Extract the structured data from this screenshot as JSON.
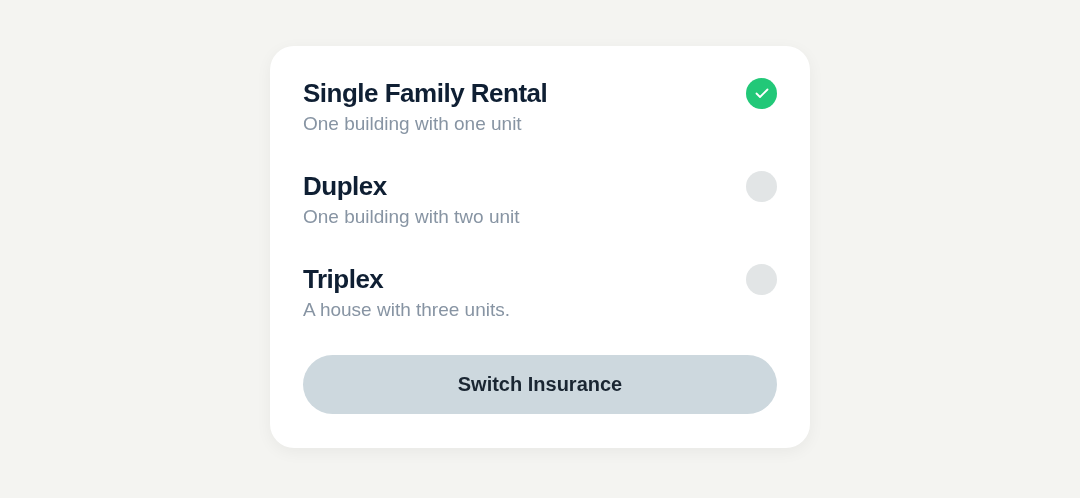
{
  "options": [
    {
      "title": "Single Family Rental",
      "description": "One building with one unit",
      "selected": true
    },
    {
      "title": "Duplex",
      "description": "One building with two unit",
      "selected": false
    },
    {
      "title": "Triplex",
      "description": "A house with three units.",
      "selected": false
    }
  ],
  "button": {
    "label": "Switch Insurance"
  }
}
